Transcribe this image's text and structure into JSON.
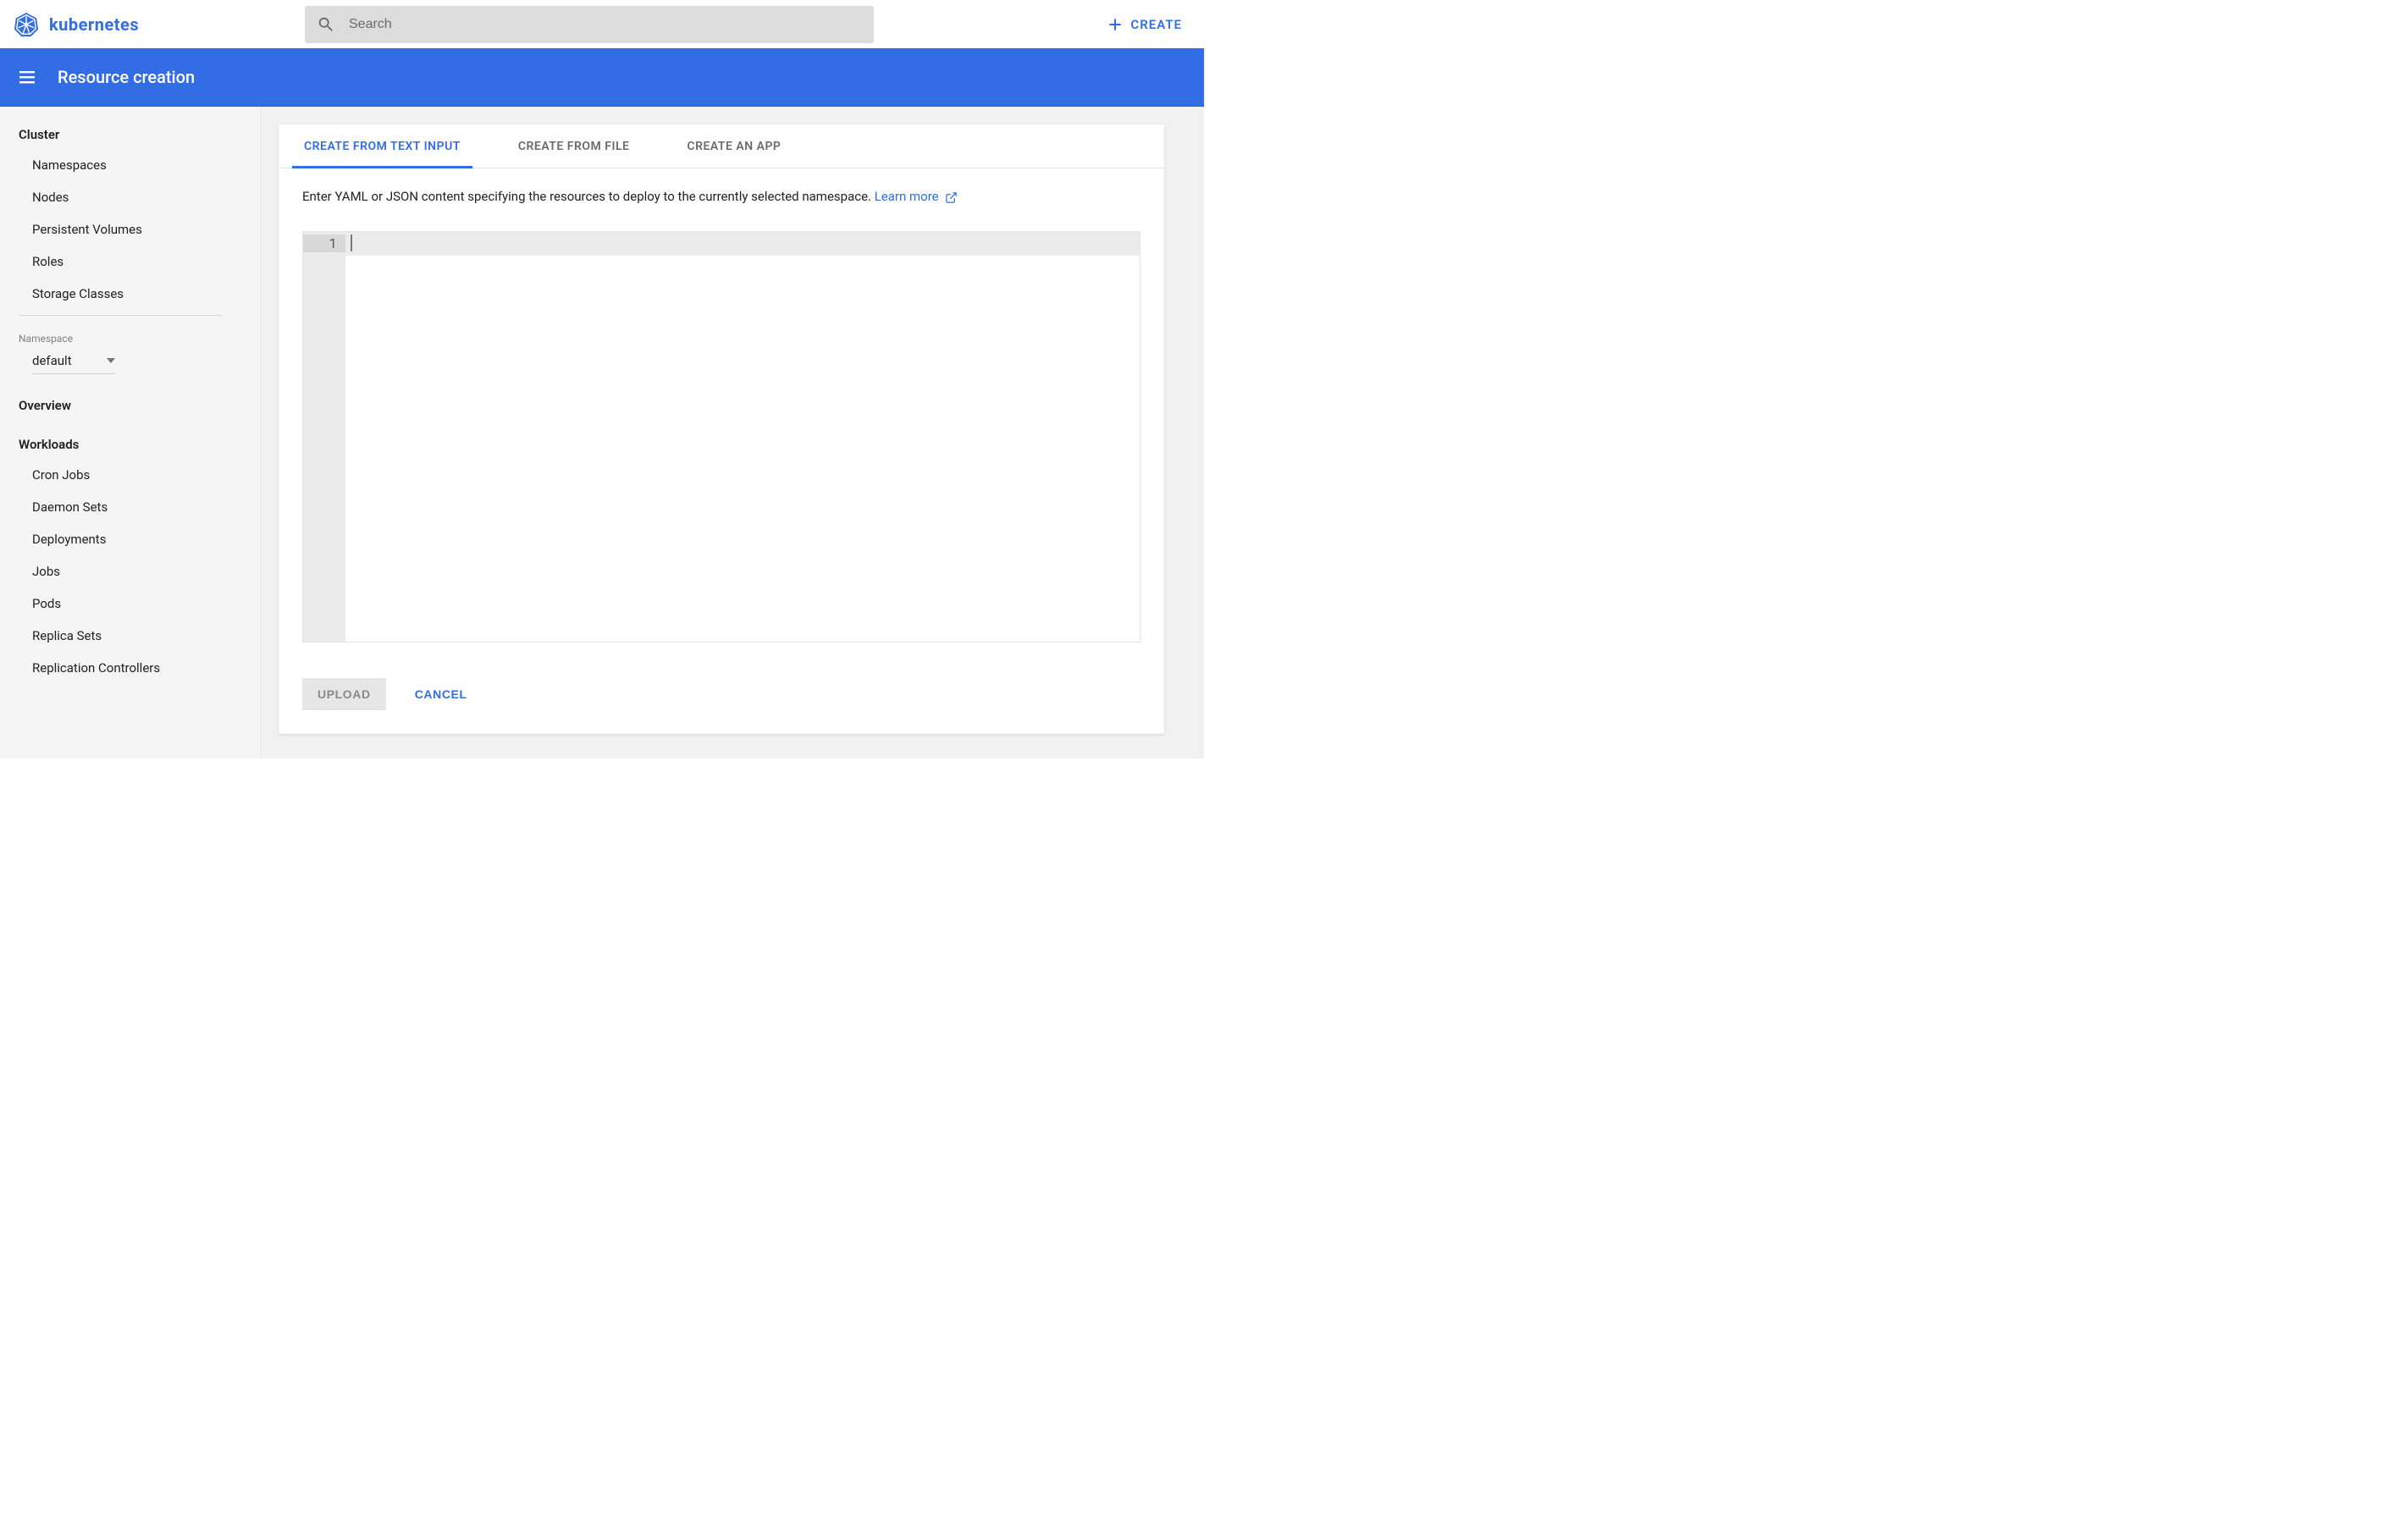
{
  "brand": {
    "name": "kubernetes"
  },
  "search": {
    "placeholder": "Search"
  },
  "header": {
    "create_label": "CREATE",
    "title": "Resource creation"
  },
  "sidebar": {
    "sections": {
      "cluster": {
        "title": "Cluster",
        "items": [
          "Namespaces",
          "Nodes",
          "Persistent Volumes",
          "Roles",
          "Storage Classes"
        ]
      },
      "namespace": {
        "label": "Namespace",
        "selected": "default"
      },
      "overview": {
        "title": "Overview"
      },
      "workloads": {
        "title": "Workloads",
        "items": [
          "Cron Jobs",
          "Daemon Sets",
          "Deployments",
          "Jobs",
          "Pods",
          "Replica Sets",
          "Replication Controllers"
        ]
      }
    }
  },
  "tabs": {
    "create_text": "CREATE FROM TEXT INPUT",
    "create_file": "CREATE FROM FILE",
    "create_app": "CREATE AN APP"
  },
  "panel": {
    "instruction": "Enter YAML or JSON content specifying the resources to deploy to the currently selected namespace. ",
    "learn_more": "Learn more",
    "line_number": "1"
  },
  "actions": {
    "upload": "UPLOAD",
    "cancel": "CANCEL"
  }
}
